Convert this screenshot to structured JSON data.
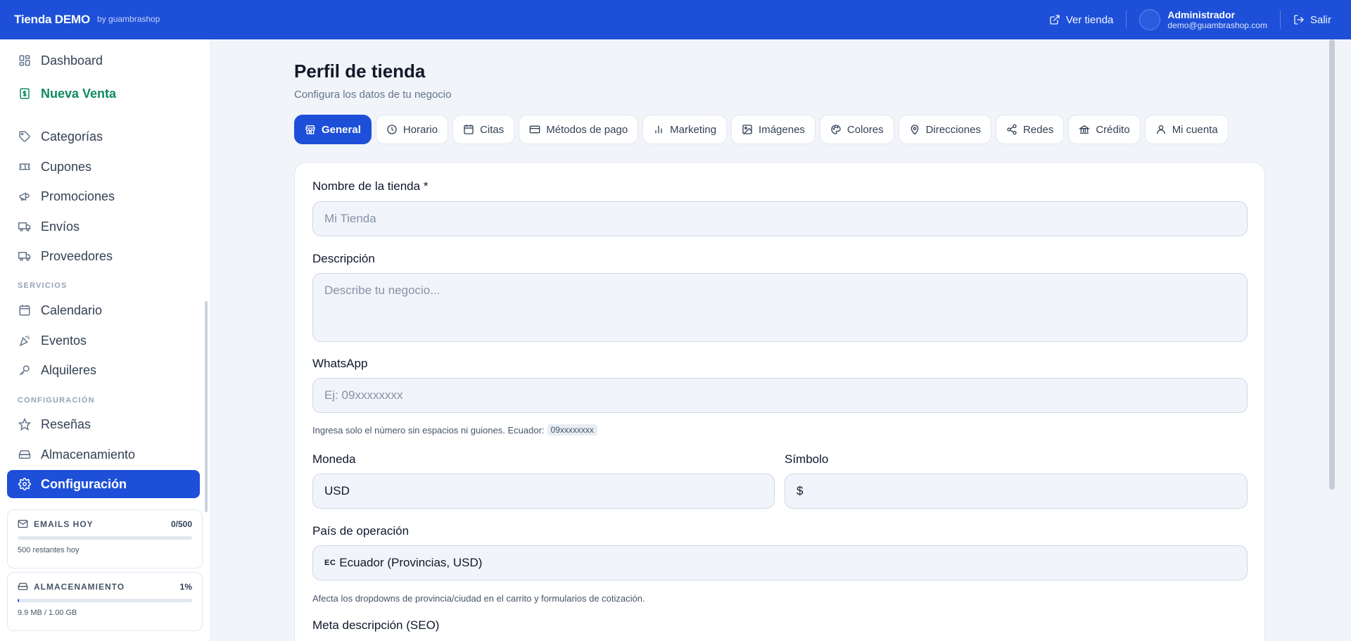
{
  "header": {
    "brand": "Tienda DEMO",
    "brand_by": "by guambrashop",
    "view_store": "Ver tienda",
    "user_name": "Administrador",
    "user_email": "demo@guambrashop.com",
    "logout": "Salir",
    "color": "#1d4fd8"
  },
  "sidebar": {
    "items": [
      {
        "label": "Dashboard",
        "icon": "dashboard-icon"
      },
      {
        "label": "Nueva Venta",
        "icon": "dollar-icon"
      },
      {
        "label": "Categorías",
        "icon": "tag-icon"
      },
      {
        "label": "Cupones",
        "icon": "ticket-icon"
      },
      {
        "label": "Promociones",
        "icon": "megaphone-icon"
      },
      {
        "label": "Envíos",
        "icon": "truck-icon"
      },
      {
        "label": "Proveedores",
        "icon": "truck-icon"
      },
      {
        "label": "Calendario",
        "icon": "calendar-icon"
      },
      {
        "label": "Eventos",
        "icon": "party-icon"
      },
      {
        "label": "Alquileres",
        "icon": "key-icon"
      },
      {
        "label": "Reseñas",
        "icon": "star-icon"
      },
      {
        "label": "Almacenamiento",
        "icon": "drive-icon"
      },
      {
        "label": "Configuración",
        "icon": "gear-icon"
      }
    ],
    "section_services": "SERVICIOS",
    "section_config": "CONFIGURACIÓN",
    "emails_widget": {
      "title": "EMAILS HOY",
      "count": "0/500",
      "footer": "500 restantes hoy",
      "fraction": 0.0
    },
    "storage_widget": {
      "title": "ALMACENAMIENTO",
      "count": "1%",
      "footer": "9.9 MB / 1.00 GB",
      "fraction": 0.01
    }
  },
  "main": {
    "title": "Perfil de tienda",
    "subtitle": "Configura los datos de tu negocio",
    "tabs": [
      {
        "label": "General",
        "icon": "store-icon"
      },
      {
        "label": "Horario",
        "icon": "clock-icon"
      },
      {
        "label": "Citas",
        "icon": "calendar-icon"
      },
      {
        "label": "Métodos de pago",
        "icon": "credit-card-icon"
      },
      {
        "label": "Marketing",
        "icon": "bar-chart-icon"
      },
      {
        "label": "Imágenes",
        "icon": "image-icon"
      },
      {
        "label": "Colores",
        "icon": "palette-icon"
      },
      {
        "label": "Direcciones",
        "icon": "map-pin-icon"
      },
      {
        "label": "Redes",
        "icon": "share-icon"
      },
      {
        "label": "Crédito",
        "icon": "bank-icon"
      },
      {
        "label": "Mi cuenta",
        "icon": "user-icon"
      }
    ],
    "form": {
      "store_name_label": "Nombre de la tienda *",
      "store_name_placeholder": "Mi Tienda",
      "description_label": "Descripción",
      "description_placeholder": "Describe tu negocio...",
      "whatsapp_label": "WhatsApp",
      "whatsapp_placeholder": "Ej: 09xxxxxxxx",
      "whatsapp_hint": "Ingresa solo el número sin espacios ni guiones. Ecuador:",
      "whatsapp_hint_code": "09xxxxxxxx",
      "currency_label": "Moneda",
      "currency_value": "USD",
      "symbol_label": "Símbolo",
      "symbol_value": "$",
      "country_label": "País de operación",
      "country_flag": "EC",
      "country_value": "Ecuador (Provincias, USD)",
      "country_hint": "Afecta los dropdowns de provincia/ciudad en el carrito y formularios de cotización.",
      "seo_label": "Meta descripción (SEO)"
    }
  }
}
